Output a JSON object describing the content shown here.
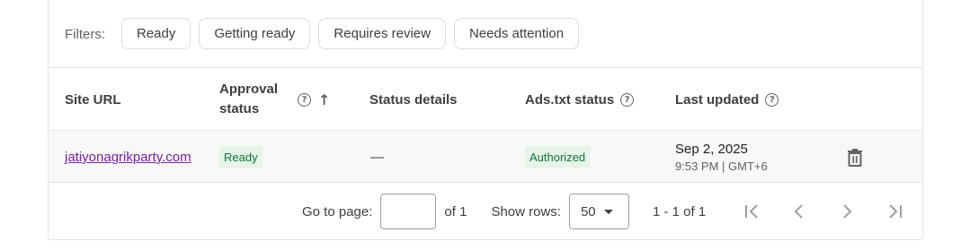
{
  "filters": {
    "label": "Filters:",
    "chips": [
      "Ready",
      "Getting ready",
      "Requires review",
      "Needs attention"
    ]
  },
  "table": {
    "columns": {
      "site_url": "Site URL",
      "approval_status_line1": "Approval",
      "approval_status_line2": "status",
      "status_details": "Status details",
      "ads_txt_status": "Ads.txt status",
      "last_updated": "Last updated"
    },
    "rows": [
      {
        "site_url": "jatiyonagrikparty.com",
        "approval_status": "Ready",
        "status_details": "—",
        "ads_txt_status": "Authorized",
        "last_updated_date": "Sep 2, 2025",
        "last_updated_time": "9:53 PM | GMT+6"
      }
    ]
  },
  "pagination": {
    "go_to_page_label": "Go to page:",
    "page_input_value": "",
    "of_pages": "of 1",
    "show_rows_label": "Show rows:",
    "rows_per_page": "50",
    "range": "1 - 1 of 1"
  },
  "icons": {
    "help": "help-circle-icon",
    "sort": "arrow-up-icon",
    "delete": "trash-icon",
    "first_page": "first-page-icon",
    "prev_page": "chevron-left-icon",
    "next_page": "chevron-right-icon",
    "last_page": "last-page-icon"
  },
  "colors": {
    "link": "#7b1fa2",
    "badge_bg": "#e6f4ea",
    "badge_text": "#137333",
    "row_bg": "#f6f9f6"
  }
}
